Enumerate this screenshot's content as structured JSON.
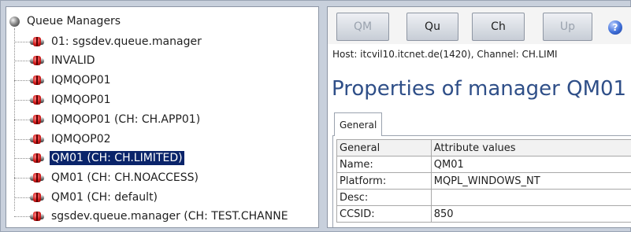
{
  "tree": {
    "root_label": "Queue Managers",
    "items": [
      {
        "label": "01: sgsdev.queue.manager",
        "selected": false
      },
      {
        "label": "INVALID",
        "selected": false
      },
      {
        "label": "IQMQOP01",
        "selected": false
      },
      {
        "label": "IQMQOP01",
        "selected": false
      },
      {
        "label": "IQMQOP01 (CH: CH.APP01)",
        "selected": false
      },
      {
        "label": "IQMQOP02",
        "selected": false
      },
      {
        "label": "QM01 (CH: CH.LIMITED)",
        "selected": true
      },
      {
        "label": "QM01 (CH: CH.NOACCESS)",
        "selected": false
      },
      {
        "label": "QM01 (CH: default)",
        "selected": false
      },
      {
        "label": "sgsdev.queue.manager (CH: TEST.CHANNE",
        "selected": false
      }
    ]
  },
  "toolbar": {
    "buttons": [
      {
        "label": "QM",
        "enabled": false
      },
      {
        "label": "Qu",
        "enabled": true
      },
      {
        "label": "Ch",
        "enabled": true
      },
      {
        "label": "Up",
        "enabled": false
      }
    ],
    "help_icon": "?"
  },
  "host_line": "Host: itcvil10.itcnet.de(1420),  Channel: CH.LIMI",
  "properties": {
    "title": "Properties of manager QM01",
    "tab_label": "General",
    "headers": [
      "General",
      "Attribute values"
    ],
    "rows": [
      [
        "Name:",
        "QM01"
      ],
      [
        "Platform:",
        "MQPL_WINDOWS_NT"
      ],
      [
        "Desc:",
        ""
      ],
      [
        "CCSID:",
        "850"
      ]
    ]
  },
  "colors": {
    "selection": "#0a246a",
    "title": "#2f4f88",
    "qm_icon": "#d21b1b"
  }
}
